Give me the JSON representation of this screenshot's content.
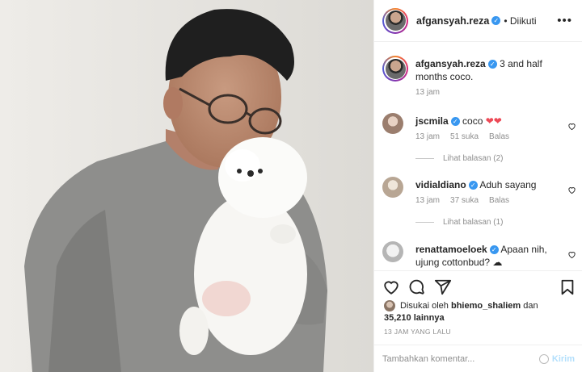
{
  "post": {
    "author": "afgansyah.reza",
    "follow_status": "• Diikuti",
    "more_icon": "more-horizontal-icon",
    "caption": "3 and half months coco.",
    "caption_time": "13 jam"
  },
  "comments": [
    {
      "user": "jscmila",
      "text": "coco",
      "emoji": "❤❤",
      "time": "13 jam",
      "likes": "51 suka",
      "reply": "Balas",
      "view_replies": "Lihat balasan (2)",
      "verified": true
    },
    {
      "user": "vidialdiano",
      "text": "Aduh sayang",
      "time": "13 jam",
      "likes": "37 suka",
      "reply": "Balas",
      "view_replies": "Lihat balasan (1)",
      "verified": true
    },
    {
      "user": "renattamoeloek",
      "text": "Apaan nih, ujung cottonbud? ☁",
      "verified": true
    }
  ],
  "actions": {
    "liked_by_prefix": "Disukai oleh",
    "liked_by_user": "bhiemo_shaliem",
    "liked_by_mid": "dan",
    "liked_by_count": "35,210 lainnya",
    "timestamp": "13 JAM YANG LALU"
  },
  "composer": {
    "placeholder": "Tambahkan komentar...",
    "send_label": "Kirim"
  },
  "colors": {
    "verified": "#3897f0",
    "heart_red": "#ed4956",
    "muted": "#8e8e8e",
    "send_disabled": "#b2dffc"
  }
}
